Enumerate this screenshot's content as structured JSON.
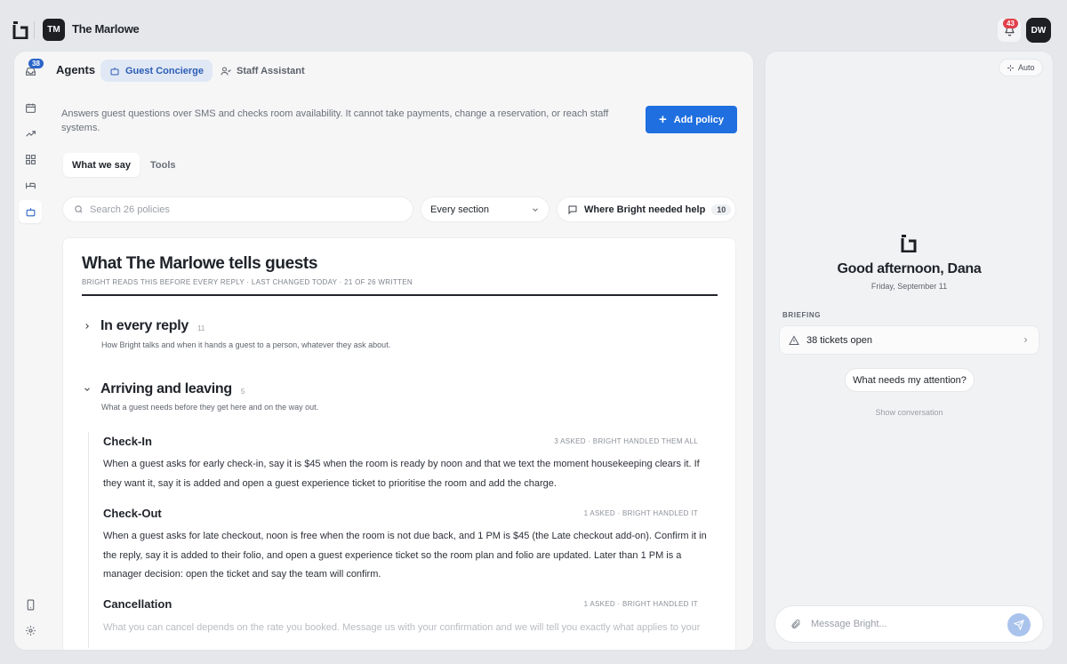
{
  "topbar": {
    "org_initials": "TM",
    "org_name": "The Marlowe",
    "notification_count": "43",
    "user_initials": "DW"
  },
  "rail": {
    "inbox_count": "38",
    "icons": [
      "inbox-icon",
      "calendar-icon",
      "trend-icon",
      "grid-icon",
      "bed-icon",
      "robot-icon",
      "phone-icon",
      "gear-icon"
    ]
  },
  "agents": {
    "title": "Agents",
    "tabs": [
      {
        "label": "Guest Concierge",
        "active": true,
        "icon": "robot-icon"
      },
      {
        "label": "Staff Assistant",
        "active": false,
        "icon": "user-icon"
      }
    ],
    "description": "Answers guest questions over SMS and checks room availability. It cannot take payments, change a reservation, or reach staff systems.",
    "add_policy_label": "Add policy",
    "subtabs": [
      {
        "label": "What we say",
        "active": true
      },
      {
        "label": "Tools",
        "active": false
      }
    ],
    "search_placeholder": "Search 26 policies",
    "section_filter": "Every section",
    "help_label": "Where Bright needed help",
    "help_count": "10"
  },
  "document": {
    "title": "What The Marlowe tells guests",
    "meta": "BRIGHT READS THIS BEFORE EVERY REPLY · LAST CHANGED TODAY · 21 OF 26 WRITTEN",
    "sections": [
      {
        "title": "In every reply",
        "count": "11",
        "subtitle": "How Bright talks and when it hands a guest to a person, whatever they ask about.",
        "expanded": false
      },
      {
        "title": "Arriving and leaving",
        "count": "5",
        "subtitle": "What a guest needs before they get here and on the way out.",
        "expanded": true
      }
    ],
    "policies": [
      {
        "title": "Check-In",
        "stat": "3 ASKED · BRIGHT HANDLED THEM ALL",
        "body": "When a guest asks for early check-in, say it is $45 when the room is ready by noon and that we text the moment housekeeping clears it. If they want it, say it is added and open a guest experience ticket to prioritise the room and add the charge."
      },
      {
        "title": "Check-Out",
        "stat": "1 ASKED · BRIGHT HANDLED IT",
        "body": "When a guest asks for late checkout, noon is free when the room is not due back, and 1 PM is $45 (the Late checkout add-on). Confirm it in the reply, say it is added to their folio, and open a guest experience ticket so the room plan and folio are updated. Later than 1 PM is a manager decision: open the ticket and say the team will confirm."
      },
      {
        "title": "Cancellation",
        "stat": "1 ASKED · BRIGHT HANDLED IT",
        "body": "What you can cancel depends on the rate you booked. Message us with your confirmation and we will tell you exactly what applies to your"
      }
    ]
  },
  "assistant": {
    "auto_label": "Auto",
    "greeting": "Good afternoon, Dana",
    "date": "Friday, September 11",
    "briefing_label": "BRIEFING",
    "tickets_label": "38 tickets open",
    "suggestion": "What needs my attention?",
    "show_conversation": "Show conversation",
    "composer_placeholder": "Message Bright..."
  }
}
